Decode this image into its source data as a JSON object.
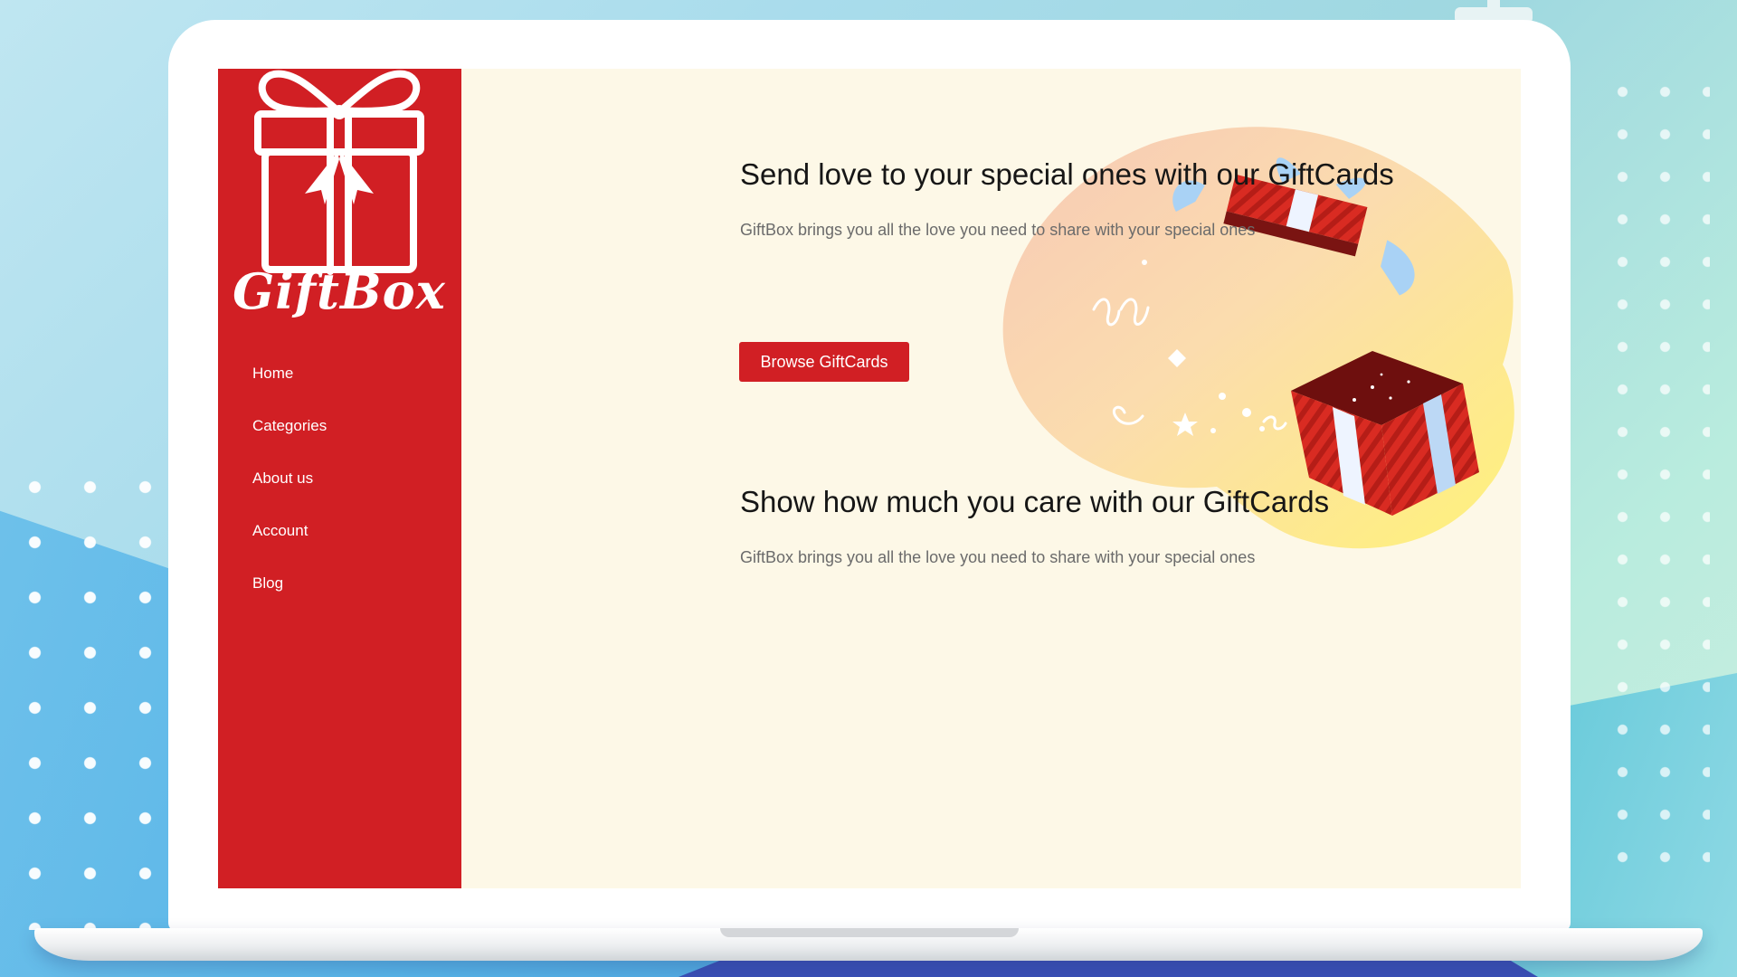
{
  "brand": {
    "name": "GiftBox",
    "color": "#d11f24"
  },
  "sidebar": {
    "items": [
      {
        "label": "Home"
      },
      {
        "label": "Categories"
      },
      {
        "label": "About us"
      },
      {
        "label": "Account"
      },
      {
        "label": "Blog"
      }
    ]
  },
  "hero": {
    "title": "Send love to your special ones with our GiftCards",
    "subtitle": "GiftBox brings you all the love you need to share with your special ones",
    "button_label": "Browse GiftCards"
  },
  "section2": {
    "title": "Show how much you care with our GiftCards",
    "subtitle": "GiftBox brings you all the love you need to share with your special ones"
  },
  "colors": {
    "screen_bg": "#fdf8e7",
    "heading": "#161616",
    "subtext": "#6b6b6b"
  }
}
